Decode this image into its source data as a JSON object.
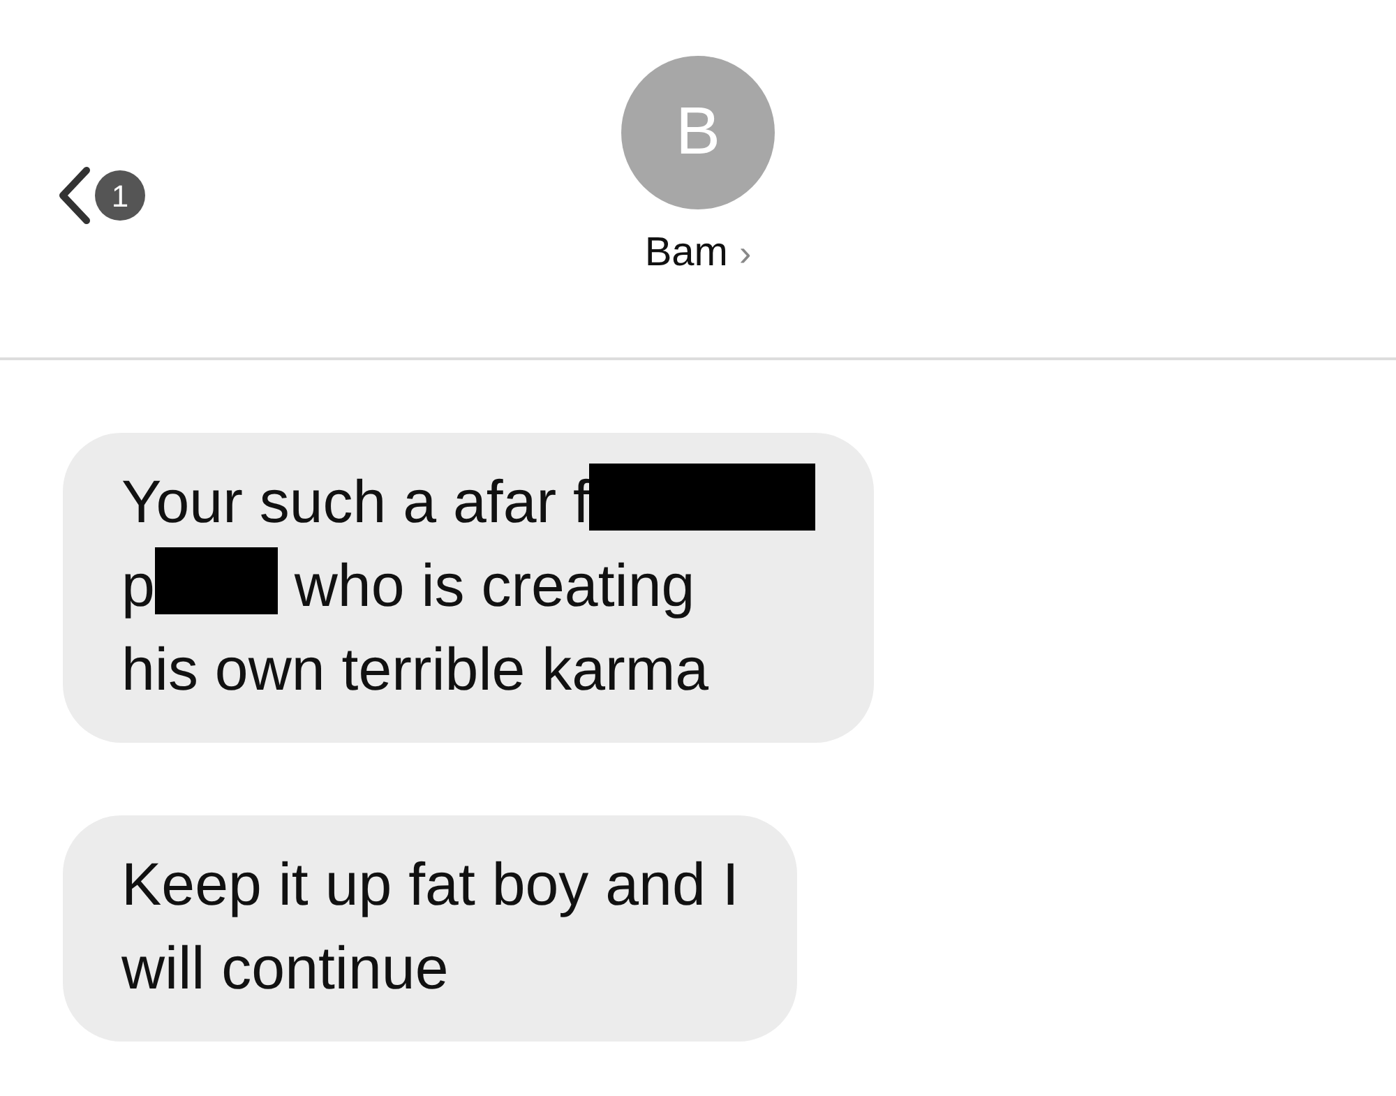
{
  "header": {
    "unread_count": "1",
    "avatar_initial": "B",
    "contact_name": "Bam",
    "name_chevron": "›"
  },
  "messages": [
    {
      "lines": [
        [
          {
            "kind": "text",
            "text": "Your such a afar f"
          },
          {
            "kind": "redaction"
          }
        ],
        [
          {
            "kind": "text",
            "text": "p"
          },
          {
            "kind": "redaction"
          },
          {
            "kind": "text",
            "text": " who is creating"
          }
        ],
        [
          {
            "kind": "text",
            "text": "his own terrible karma"
          }
        ]
      ]
    },
    {
      "lines": [
        [
          {
            "kind": "text",
            "text": "Keep it up fat boy and I"
          }
        ],
        [
          {
            "kind": "text",
            "text": "will continue"
          }
        ]
      ]
    }
  ]
}
